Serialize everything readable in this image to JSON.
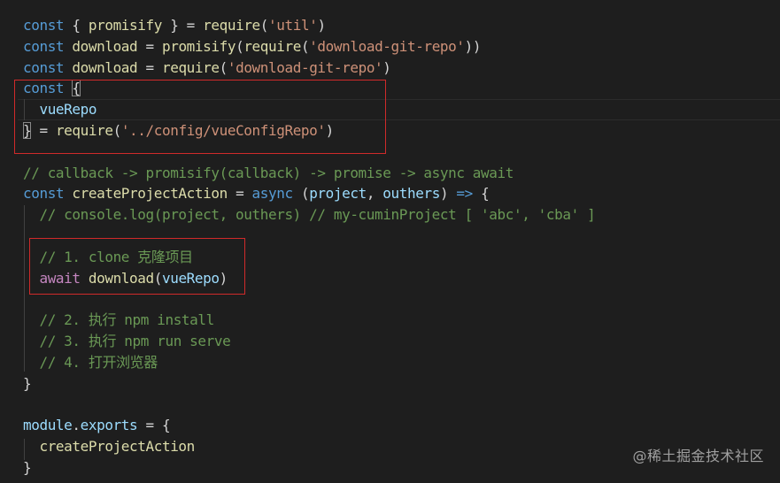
{
  "editor": {
    "lines": [
      [
        [
          "keyword",
          "const"
        ],
        [
          "punct",
          " { "
        ],
        [
          "func",
          "promisify"
        ],
        [
          "punct",
          " } = "
        ],
        [
          "func",
          "require"
        ],
        [
          "punct",
          "("
        ],
        [
          "string",
          "'util'"
        ],
        [
          "punct",
          ")"
        ]
      ],
      [
        [
          "keyword",
          "const"
        ],
        [
          "punct",
          " "
        ],
        [
          "func",
          "download"
        ],
        [
          "punct",
          " = "
        ],
        [
          "func",
          "promisify"
        ],
        [
          "punct",
          "("
        ],
        [
          "func",
          "require"
        ],
        [
          "punct",
          "("
        ],
        [
          "string",
          "'download-git-repo'"
        ],
        [
          "punct",
          "))"
        ]
      ],
      [
        [
          "keyword",
          "const"
        ],
        [
          "punct",
          " "
        ],
        [
          "func",
          "download"
        ],
        [
          "punct",
          " = "
        ],
        [
          "func",
          "require"
        ],
        [
          "punct",
          "("
        ],
        [
          "string",
          "'download-git-repo'"
        ],
        [
          "punct",
          ")"
        ]
      ],
      [
        [
          "keyword",
          "const"
        ],
        [
          "punct",
          " "
        ],
        [
          "bracket-match",
          "{"
        ]
      ],
      [
        [
          "punct",
          "  "
        ],
        [
          "var",
          "vueRepo"
        ]
      ],
      [
        [
          "bracket-match",
          "}"
        ],
        [
          "punct",
          " = "
        ],
        [
          "func",
          "require"
        ],
        [
          "punct",
          "("
        ],
        [
          "string",
          "'../config/vueConfigRepo'"
        ],
        [
          "punct",
          ")"
        ]
      ],
      [],
      [
        [
          "comment",
          "// callback -> promisify(callback) -> promise -> async await"
        ]
      ],
      [
        [
          "keyword",
          "const"
        ],
        [
          "punct",
          " "
        ],
        [
          "func",
          "createProjectAction"
        ],
        [
          "punct",
          " = "
        ],
        [
          "keyword",
          "async"
        ],
        [
          "punct",
          " ("
        ],
        [
          "var",
          "project"
        ],
        [
          "punct",
          ", "
        ],
        [
          "var",
          "outhers"
        ],
        [
          "punct",
          ") "
        ],
        [
          "keyword",
          "=>"
        ],
        [
          "punct",
          " {"
        ]
      ],
      [
        [
          "punct",
          "  "
        ],
        [
          "comment",
          "// console.log(project, outhers) // my-cuminProject [ 'abc', 'cba' ]"
        ]
      ],
      [],
      [
        [
          "punct",
          "  "
        ],
        [
          "comment",
          "// 1. clone 克隆项目"
        ]
      ],
      [
        [
          "punct",
          "  "
        ],
        [
          "control",
          "await"
        ],
        [
          "punct",
          " "
        ],
        [
          "func",
          "download"
        ],
        [
          "punct",
          "("
        ],
        [
          "var",
          "vueRepo"
        ],
        [
          "punct",
          ")"
        ]
      ],
      [],
      [
        [
          "punct",
          "  "
        ],
        [
          "comment",
          "// 2. 执行 npm install"
        ]
      ],
      [
        [
          "punct",
          "  "
        ],
        [
          "comment",
          "// 3. 执行 npm run serve"
        ]
      ],
      [
        [
          "punct",
          "  "
        ],
        [
          "comment",
          "// 4. 打开浏览器"
        ]
      ],
      [
        [
          "punct",
          "}"
        ]
      ],
      [],
      [
        [
          "var",
          "module"
        ],
        [
          "punct",
          "."
        ],
        [
          "var",
          "exports"
        ],
        [
          "punct",
          " = {"
        ]
      ],
      [
        [
          "punct",
          "  "
        ],
        [
          "func",
          "createProjectAction"
        ]
      ],
      [
        [
          "punct",
          "}"
        ]
      ]
    ]
  },
  "watermark": "@稀土掘金技术社区",
  "colors": {
    "background": "#1e1e1e",
    "keyword": "#569cd6",
    "control": "#c586c0",
    "variable": "#9cdcfe",
    "function": "#dcdcaa",
    "string": "#ce9178",
    "comment": "#6a9955",
    "highlight_box": "#d02a2a"
  }
}
